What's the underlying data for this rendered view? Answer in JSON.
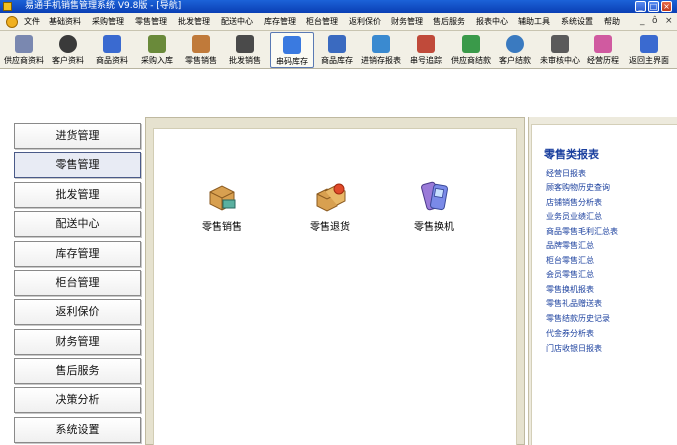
{
  "window": {
    "title": "易通手机销售管理系统  V9.8版 - [导航]",
    "controls": [
      "_",
      "□",
      "×"
    ]
  },
  "menubar": {
    "items": [
      "文件",
      "基础资料",
      "采购管理",
      "零售管理",
      "批发管理",
      "配送中心",
      "库存管理",
      "柜台管理",
      "返利保价",
      "财务管理",
      "售后服务",
      "报表中心",
      "辅助工具",
      "系统设置",
      "帮助"
    ],
    "mdi_controls": [
      "_",
      "ô",
      "×"
    ]
  },
  "toolbar": {
    "buttons": [
      {
        "label": "供应商资料",
        "icon": "supplier-card-icon",
        "color": "#7a88b0"
      },
      {
        "label": "客户资料",
        "icon": "customer-person-icon",
        "color": "#3a3a3a"
      },
      {
        "label": "商品资料",
        "icon": "product-grid-icon",
        "color": "#3a6ad0"
      },
      {
        "label": "采购入库",
        "icon": "purchase-in-icon",
        "color": "#6a8a3a"
      },
      {
        "label": "零售销售",
        "icon": "retail-sale-icon",
        "color": "#c07a3a"
      },
      {
        "label": "批发销售",
        "icon": "wholesale-icon",
        "color": "#4a4a4a"
      },
      {
        "label": "串码库存",
        "icon": "serial-stock-house-icon",
        "color": "#3a7ae0"
      },
      {
        "label": "商品库存",
        "icon": "product-stock-icon",
        "color": "#3a6ac0"
      },
      {
        "label": "进销存报表",
        "icon": "report-icon",
        "color": "#3a8ad0"
      },
      {
        "label": "串号追踪",
        "icon": "serial-track-house-icon",
        "color": "#c04a3a"
      },
      {
        "label": "供应商结款",
        "icon": "supplier-settle-icon",
        "color": "#3a9a4a"
      },
      {
        "label": "客户结款",
        "icon": "customer-settle-globe-icon",
        "color": "#3a7ac0"
      },
      {
        "label": "未审核中心",
        "icon": "unaudited-icon",
        "color": "#5a5a5a"
      },
      {
        "label": "经营历程",
        "icon": "business-history-icon",
        "color": "#d05aa0"
      },
      {
        "label": "返回主界面",
        "icon": "home-grid-icon",
        "color": "#3a6ad0"
      }
    ],
    "active_index": 6
  },
  "nav": {
    "items": [
      "进货管理",
      "零售管理",
      "批发管理",
      "配送中心",
      "库存管理",
      "柜台管理",
      "返利保价",
      "财务管理",
      "售后服务",
      "决策分析",
      "系统设置"
    ],
    "selected_index": 1
  },
  "functions": [
    {
      "label": "零售销售",
      "icon": "retail-sale-box-icon"
    },
    {
      "label": "零售退货",
      "icon": "retail-return-box-icon"
    },
    {
      "label": "零售换机",
      "icon": "retail-exchange-phone-icon"
    }
  ],
  "report_panel": {
    "title": "零售类报表",
    "links": [
      "经营日报表",
      "顾客购物历史查询",
      "店铺销售分析表",
      "业务员业绩汇总",
      "商品零售毛利汇总表",
      "品牌零售汇总",
      "柜台零售汇总",
      "会员零售汇总",
      "零售换机报表",
      "零售礼品赠送表",
      "零售结款历史记录",
      "代金券分析表",
      "门店收银日报表"
    ]
  }
}
